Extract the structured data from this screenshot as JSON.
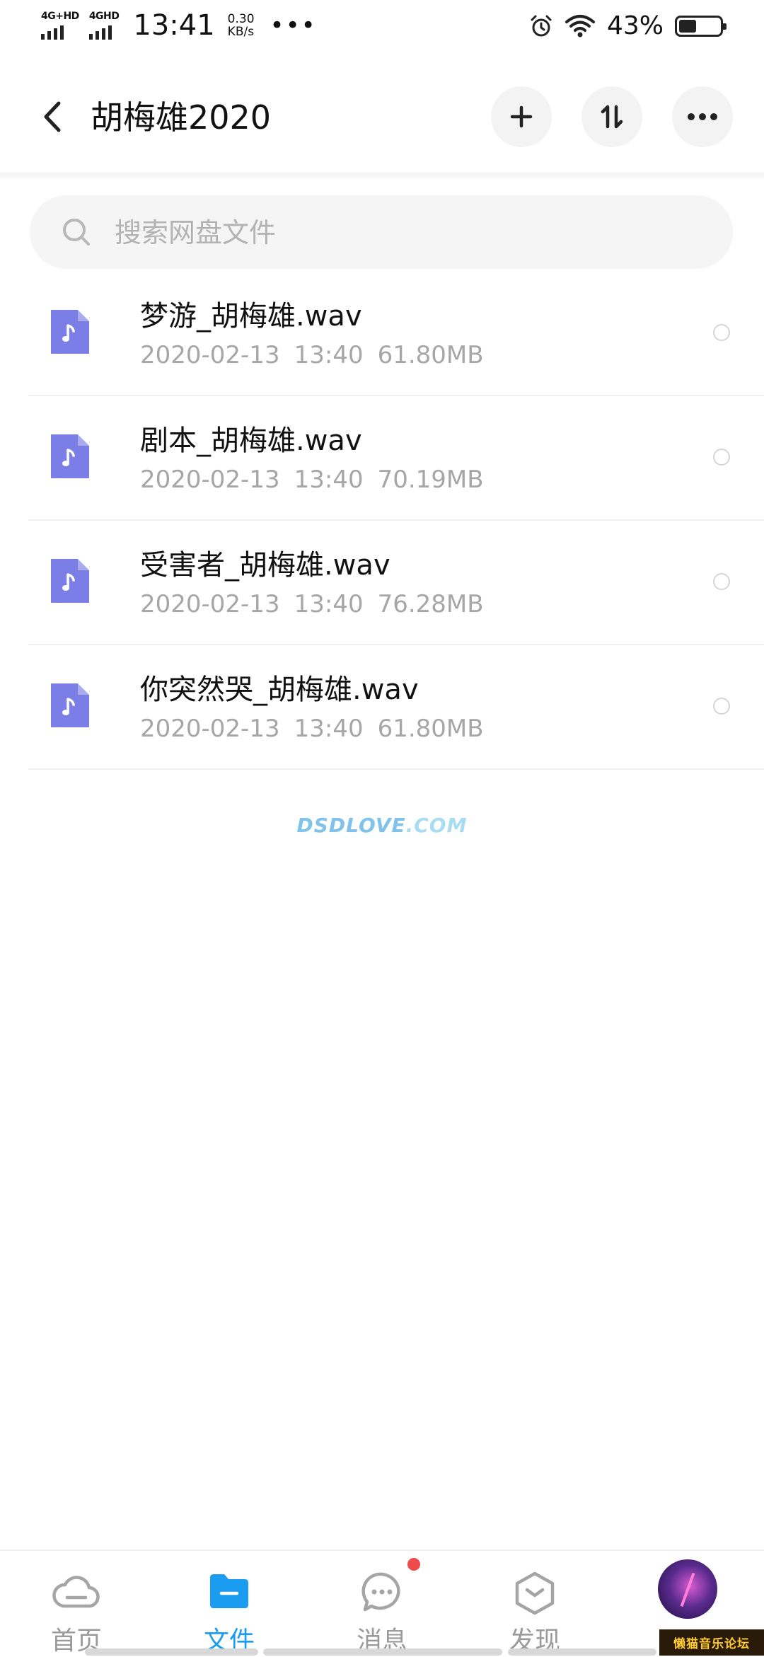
{
  "status_bar": {
    "sim1_label": "4G+HD",
    "sim2_label": "4GHD",
    "time": "13:41",
    "speed_value": "0.30",
    "speed_unit": "KB/s",
    "more": "•••",
    "battery_pct": "43%",
    "battery_level": 0.43
  },
  "header": {
    "title": "胡梅雄2020",
    "icons": [
      "back-icon",
      "plus-icon",
      "sort-icon",
      "more-icon"
    ]
  },
  "search": {
    "placeholder": "搜索网盘文件"
  },
  "files": [
    {
      "name": "梦游_胡梅雄.wav",
      "date": "2020-02-13",
      "time": "13:40",
      "size": "61.80MB"
    },
    {
      "name": "剧本_胡梅雄.wav",
      "date": "2020-02-13",
      "time": "13:40",
      "size": "70.19MB"
    },
    {
      "name": "受害者_胡梅雄.wav",
      "date": "2020-02-13",
      "time": "13:40",
      "size": "76.28MB"
    },
    {
      "name": "你突然哭_胡梅雄.wav",
      "date": "2020-02-13",
      "time": "13:40",
      "size": "61.80MB"
    }
  ],
  "watermark": {
    "left": "DSDLOVE",
    "right": ".COM"
  },
  "bottom_nav": {
    "items": [
      {
        "label": "首页",
        "icon": "cloud-icon"
      },
      {
        "label": "文件",
        "icon": "folder-icon"
      },
      {
        "label": "消息",
        "icon": "chat-icon"
      },
      {
        "label": "发现",
        "icon": "discover-icon"
      }
    ],
    "active": "文件"
  },
  "corner_stamp": "懒猫音乐论坛",
  "colors": {
    "accent": "#1a9cf0",
    "audio_icon": "#7b7ee6",
    "badge": "#ef4b4b",
    "meta_text": "#a6a6a6"
  }
}
